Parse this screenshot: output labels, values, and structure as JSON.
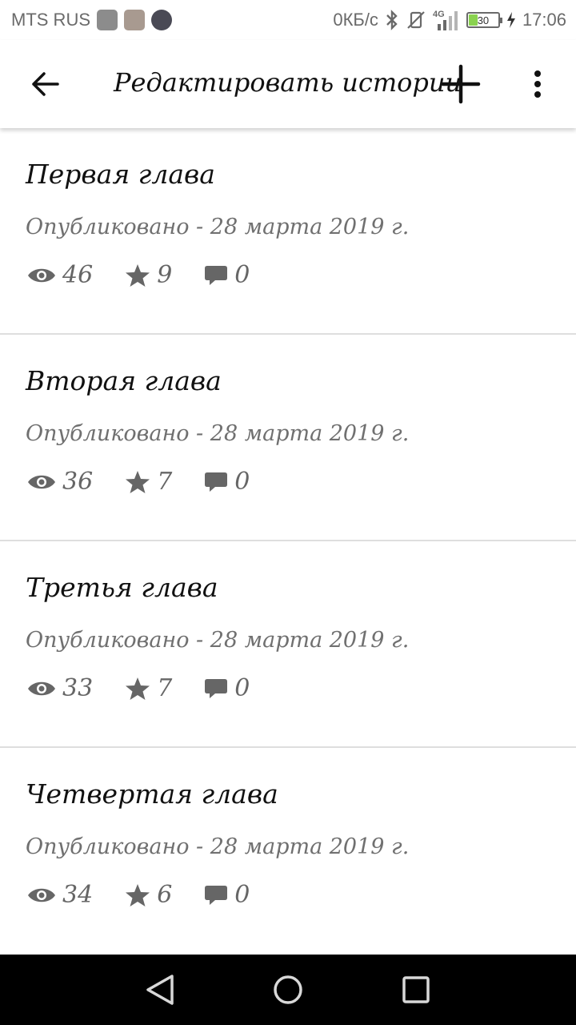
{
  "status_bar": {
    "carrier": "MTS RUS",
    "net_speed": "0КБ/с",
    "network": "4G",
    "battery": "30",
    "time": "17:06"
  },
  "app_bar": {
    "title": "Редактировать истории"
  },
  "stories": [
    {
      "title": "Первая глава",
      "published": "Опубликовано - 28 марта 2019 г.",
      "views": "46",
      "votes": "9",
      "comments": "0"
    },
    {
      "title": "Вторая глава",
      "published": "Опубликовано - 28 марта 2019 г.",
      "views": "36",
      "votes": "7",
      "comments": "0"
    },
    {
      "title": "Третья глава",
      "published": "Опубликовано - 28 марта 2019 г.",
      "views": "33",
      "votes": "7",
      "comments": "0"
    },
    {
      "title": "Четвертая глава",
      "published": "Опубликовано - 28 марта 2019 г.",
      "views": "34",
      "votes": "6",
      "comments": "0"
    }
  ],
  "icons": {
    "back": "arrow-left-icon",
    "add": "plus-icon",
    "more": "more-vert-icon",
    "views": "eye-icon",
    "votes": "star-icon",
    "comments": "comment-icon"
  },
  "colors": {
    "battery_fill": "#8ad24f",
    "stat_gray": "#666666",
    "nav_bar": "#000000"
  }
}
